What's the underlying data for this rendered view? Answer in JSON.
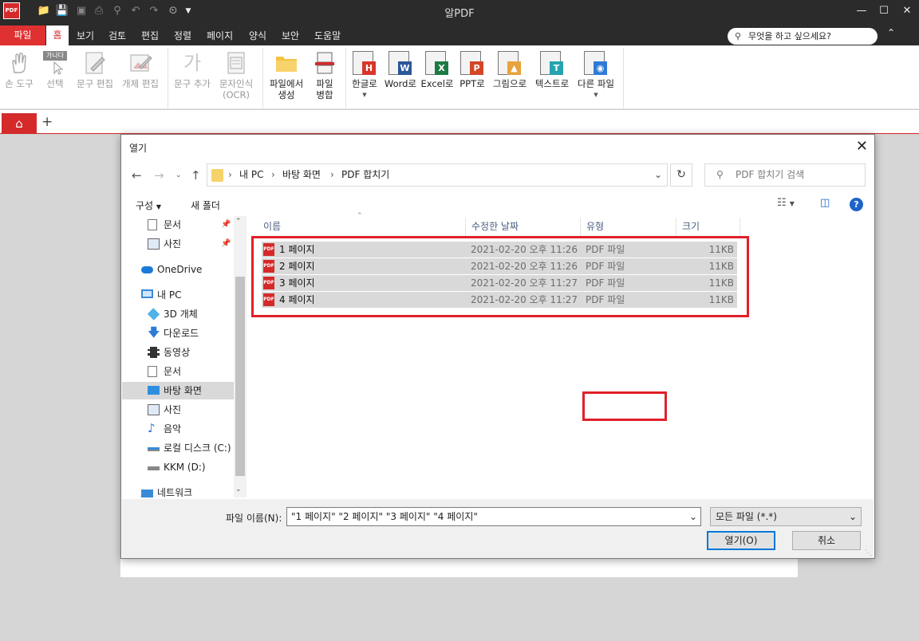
{
  "app": {
    "title": "알PDF",
    "logo_text": "PDF"
  },
  "menu": {
    "file": "파일",
    "home": "홈",
    "items": [
      "보기",
      "검토",
      "편집",
      "정렬",
      "페이지",
      "양식",
      "보안",
      "도움말"
    ],
    "search_placeholder": "무엇을 하고 싶으세요?"
  },
  "ribbon": {
    "hand": "손 도구",
    "select": "선택",
    "select_badge": "가나다",
    "text_edit": "문구 편집",
    "object_edit": "개체 편집",
    "add_text": "문구 추가",
    "add_text_glyph": "가",
    "ocr_line1": "문자인식",
    "ocr_line2": "(OCR)",
    "create_line1": "파일에서",
    "create_line2": "생성",
    "merge_line1": "파일",
    "merge_line2": "병합",
    "to_hangul": "한글로",
    "to_word": "Word로",
    "to_excel": "Excel로",
    "to_ppt": "PPT로",
    "to_image": "그림으로",
    "to_text": "텍스트로",
    "to_other": "다른 파일",
    "badges": {
      "hangul": "H",
      "word": "W",
      "excel": "X",
      "ppt": "P",
      "text": "T"
    },
    "colors": {
      "hangul": "#d9362b",
      "word": "#2b5797",
      "excel": "#1e7a45",
      "ppt": "#d24726",
      "image": "#e8a33c",
      "text": "#26a3b0",
      "other": "#2e7bd6"
    }
  },
  "dialog": {
    "title": "열기",
    "path": [
      "내 PC",
      "바탕 화면",
      "PDF 합치기"
    ],
    "search_placeholder": "PDF 합치기 검색",
    "organize": "구성",
    "new_folder": "새 폴더",
    "help": "?",
    "nav": [
      {
        "label": "문서",
        "icon": "document-icon",
        "pinned": true
      },
      {
        "label": "사진",
        "icon": "picture-icon",
        "pinned": true
      },
      {
        "label": "OneDrive",
        "icon": "cloud-icon"
      },
      {
        "label": "내 PC",
        "icon": "computer-icon"
      },
      {
        "label": "3D 개체",
        "icon": "cube-icon"
      },
      {
        "label": "다운로드",
        "icon": "download-icon"
      },
      {
        "label": "동영상",
        "icon": "video-icon"
      },
      {
        "label": "문서",
        "icon": "document-icon"
      },
      {
        "label": "바탕 화면",
        "icon": "desktop-icon",
        "selected": true
      },
      {
        "label": "사진",
        "icon": "picture-icon"
      },
      {
        "label": "음악",
        "icon": "music-icon"
      },
      {
        "label": "로컬 디스크 (C:)",
        "icon": "drive-icon"
      },
      {
        "label": "KKM (D:)",
        "icon": "drive-icon"
      },
      {
        "label": "네트워크",
        "icon": "network-icon"
      }
    ],
    "columns": {
      "name": "이름",
      "date": "수정한 날짜",
      "type": "유형",
      "size": "크기"
    },
    "files": [
      {
        "name": "1 페이지",
        "date": "2021-02-20 오후 11:26",
        "type": "PDF 파일",
        "size": "11KB"
      },
      {
        "name": "2 페이지",
        "date": "2021-02-20 오후 11:26",
        "type": "PDF 파일",
        "size": "11KB"
      },
      {
        "name": "3 페이지",
        "date": "2021-02-20 오후 11:27",
        "type": "PDF 파일",
        "size": "11KB"
      },
      {
        "name": "4 페이지",
        "date": "2021-02-20 오후 11:27",
        "type": "PDF 파일",
        "size": "11KB"
      }
    ],
    "file_icon_text": "PDF",
    "filename_label": "파일 이름(N):",
    "filename_value": "\"1 페이지\" \"2 페이지\" \"3 페이지\" \"4 페이지\"",
    "filter": "모든 파일 (*.*)",
    "open_button": "열기(O)",
    "cancel_button": "취소",
    "highlight_color": "#e0202a"
  }
}
